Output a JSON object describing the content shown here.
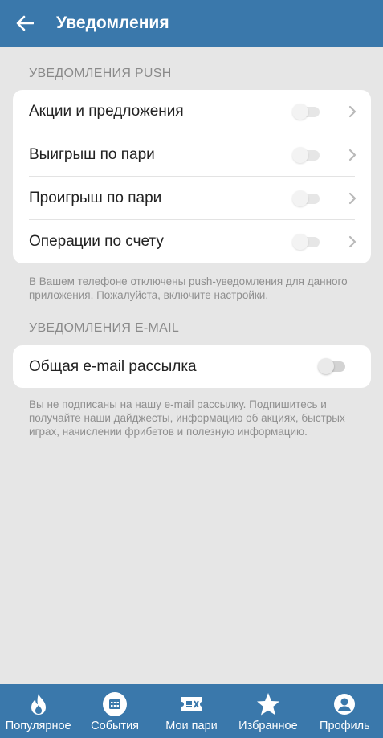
{
  "appbar": {
    "title": "Уведомления",
    "back_icon": "arrow-left-icon"
  },
  "push": {
    "header": "УВЕДОМЛЕНИЯ PUSH",
    "items": [
      {
        "label": "Акции и предложения",
        "enabled": false
      },
      {
        "label": "Выигрыш по пари",
        "enabled": false
      },
      {
        "label": "Проигрыш по пари",
        "enabled": false
      },
      {
        "label": "Операции по счету",
        "enabled": false
      }
    ],
    "note": "В Вашем телефоне отключены push-уведомления для данного приложения. Пожалуйста, включите настройки."
  },
  "email": {
    "header": "УВЕДОМЛЕНИЯ E-MAIL",
    "items": [
      {
        "label": "Общая e-mail рассылка",
        "enabled": false
      }
    ],
    "note": "Вы не подписаны на нашу e-mail рассылку. Подпишитесь и получайте наши дайджесты, информацию об акциях, быстрых играх, начислении фрибетов и полезную информацию."
  },
  "tabbar": {
    "items": [
      {
        "label": "Популярное",
        "icon": "flame-icon"
      },
      {
        "label": "События",
        "icon": "calendar-icon"
      },
      {
        "label": "Мои пари",
        "icon": "ticket-icon"
      },
      {
        "label": "Избранное",
        "icon": "star-icon"
      },
      {
        "label": "Профиль",
        "icon": "profile-icon"
      }
    ]
  },
  "colors": {
    "primary": "#3a78ab",
    "background": "#e6e6e6",
    "card": "#ffffff"
  }
}
